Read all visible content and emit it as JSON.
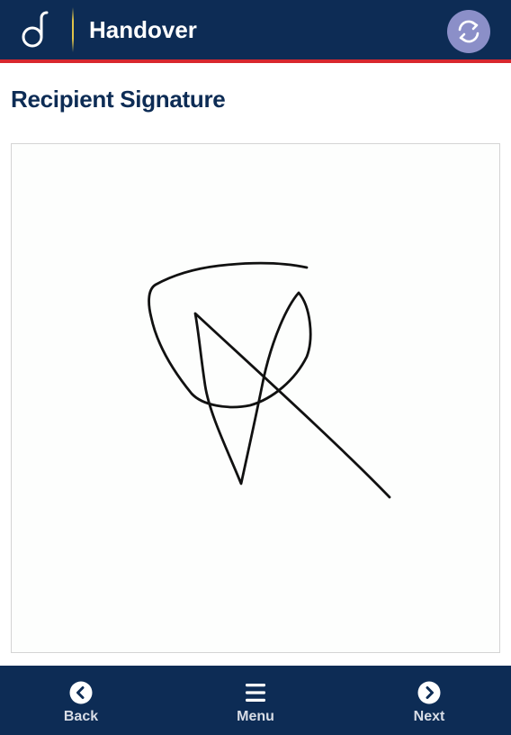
{
  "header": {
    "title": "Handover",
    "logo_icon": "logo-d-icon",
    "sync_icon": "sync-icon",
    "colors": {
      "background": "#0d2c55",
      "stripe": "#d8282e",
      "sync_button": "#8b8fc8"
    }
  },
  "page": {
    "title": "Recipient Signature"
  },
  "signature_pad": {
    "state": "signed",
    "stroke_color": "#111111"
  },
  "bottom_nav": {
    "back": {
      "label": "Back",
      "icon": "chevron-left-circle-icon"
    },
    "menu": {
      "label": "Menu",
      "icon": "hamburger-menu-icon"
    },
    "next": {
      "label": "Next",
      "icon": "chevron-right-circle-icon"
    }
  }
}
